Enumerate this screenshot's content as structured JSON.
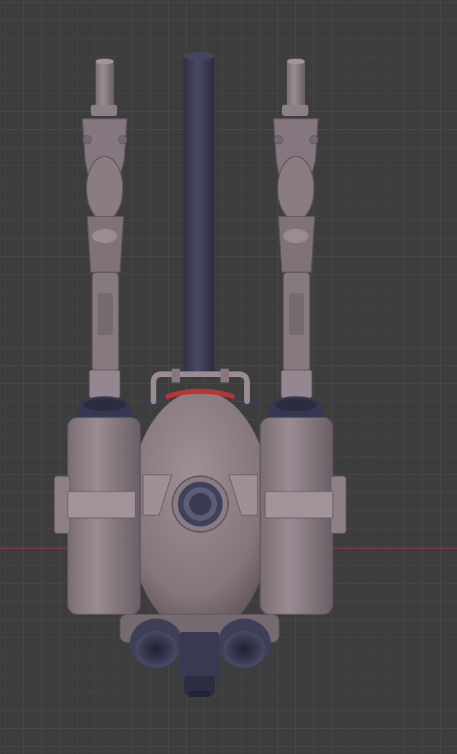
{
  "viewport": {
    "background_color": "#3d3d3d",
    "grid_color": "#474747",
    "x_axis_color": "#8a3a3a"
  },
  "model": {
    "subject": "backpack-robot-model",
    "body_color": "#8e8086",
    "shadow_color": "#5e535a",
    "dark_part_color": "#3c3d52",
    "accent_color": "#b83535"
  }
}
